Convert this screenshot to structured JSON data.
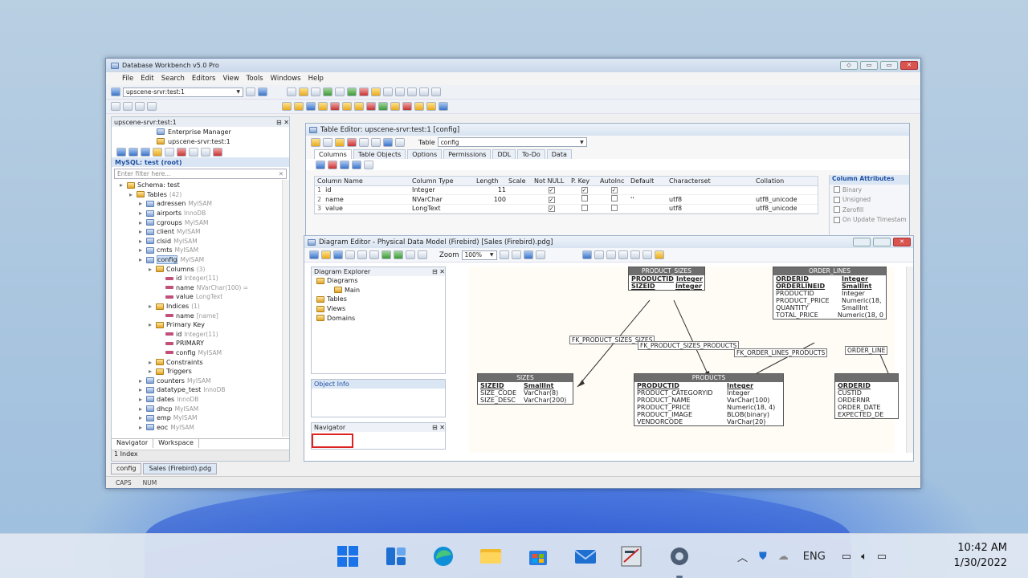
{
  "window": {
    "title": "Database Workbench v5.0 Pro",
    "buttons": [
      "◇",
      "▭",
      "▭",
      "✕"
    ]
  },
  "menu": [
    "File",
    "Edit",
    "Search",
    "Editors",
    "View",
    "Tools",
    "Windows",
    "Help"
  ],
  "toolbar": {
    "server_combo": "upscene-srvr:test:1"
  },
  "left": {
    "header": "upscene-srvr:test:1",
    "items": [
      "Enterprise Manager",
      "upscene-srvr:test:1"
    ],
    "connection": "MySQL: test (root)",
    "filter_placeholder": "Enter filter here...",
    "tree": [
      {
        "label": "Schema: test",
        "extra": "",
        "indent": 0
      },
      {
        "label": "Tables",
        "extra": "(42)",
        "indent": 1
      },
      {
        "label": "adressen",
        "extra": "MyISAM",
        "indent": 2
      },
      {
        "label": "airports",
        "extra": "InnoDB",
        "indent": 2
      },
      {
        "label": "cgroups",
        "extra": "MyISAM",
        "indent": 2
      },
      {
        "label": "client",
        "extra": "MyISAM",
        "indent": 2
      },
      {
        "label": "clsid",
        "extra": "MyISAM",
        "indent": 2
      },
      {
        "label": "cmts",
        "extra": "MyISAM",
        "indent": 2
      },
      {
        "label": "config",
        "extra": "MyISAM",
        "indent": 2,
        "selected": true
      },
      {
        "label": "Columns",
        "extra": "(3)",
        "indent": 3
      },
      {
        "label": "id",
        "extra": "Integer(11)",
        "indent": 4
      },
      {
        "label": "name",
        "extra": "NVarChar(100) =",
        "indent": 4
      },
      {
        "label": "value",
        "extra": "LongText",
        "indent": 4
      },
      {
        "label": "Indices",
        "extra": "(1)",
        "indent": 3
      },
      {
        "label": "name",
        "extra": "[name]",
        "indent": 4
      },
      {
        "label": "Primary Key",
        "extra": "",
        "indent": 3
      },
      {
        "label": "id",
        "extra": "Integer(11)",
        "indent": 4
      },
      {
        "label": "PRIMARY",
        "extra": "",
        "indent": 4
      },
      {
        "label": "config",
        "extra": "MyISAM",
        "indent": 4
      },
      {
        "label": "Constraints",
        "extra": "",
        "indent": 3
      },
      {
        "label": "Triggers",
        "extra": "",
        "indent": 3
      },
      {
        "label": "counters",
        "extra": "MyISAM",
        "indent": 2
      },
      {
        "label": "datatype_test",
        "extra": "InnoDB",
        "indent": 2
      },
      {
        "label": "dates",
        "extra": "InnoDB",
        "indent": 2
      },
      {
        "label": "dhcp",
        "extra": "MyISAM",
        "indent": 2
      },
      {
        "label": "emp",
        "extra": "MyISAM",
        "indent": 2
      },
      {
        "label": "eoc",
        "extra": "MyISAM",
        "indent": 2
      }
    ],
    "tabs": [
      "Navigator",
      "Workspace"
    ],
    "status": "1 Index"
  },
  "table_editor": {
    "title": "Table Editor: upscene-srvr:test:1 [config]",
    "table_label": "Table",
    "table_value": "config",
    "tabs": [
      "Columns",
      "Table Objects",
      "Options",
      "Permissions",
      "DDL",
      "To-Do",
      "Data"
    ],
    "columns": [
      "Column Name",
      "Column Type",
      "Length",
      "Scale",
      "Not NULL",
      "P. Key",
      "AutoInc",
      "Default",
      "Characterset",
      "Collation"
    ],
    "rows": [
      {
        "num": "1",
        "name": "id",
        "type": "Integer",
        "length": "11",
        "scale": "",
        "notnull": true,
        "pkey": true,
        "autoinc": true,
        "default": "",
        "charset": "",
        "collation": ""
      },
      {
        "num": "2",
        "name": "name",
        "type": "NVarChar",
        "length": "100",
        "scale": "",
        "notnull": true,
        "pkey": false,
        "autoinc": false,
        "default": "''",
        "charset": "utf8",
        "collation": "utf8_unicode"
      },
      {
        "num": "3",
        "name": "value",
        "type": "LongText",
        "length": "",
        "scale": "",
        "notnull": true,
        "pkey": false,
        "autoinc": false,
        "default": "",
        "charset": "utf8",
        "collation": "utf8_unicode"
      }
    ],
    "attributes": {
      "title": "Column Attributes",
      "options": [
        "Binary",
        "Unsigned",
        "Zerofill",
        "On Update Timestam"
      ]
    }
  },
  "diagram_editor": {
    "title": "Diagram Editor - Physical Data Model (Firebird) [Sales (Firebird).pdg]",
    "zoom_label": "Zoom",
    "zoom_value": "100%",
    "explorer": {
      "title": "Diagram Explorer",
      "items": [
        {
          "label": "Diagrams",
          "indent": 0
        },
        {
          "label": "Main",
          "indent": 1
        },
        {
          "label": "Tables",
          "indent": 0
        },
        {
          "label": "Views",
          "indent": 0
        },
        {
          "label": "Domains",
          "indent": 0
        }
      ]
    },
    "object_info": "Object Info",
    "navigator": "Navigator",
    "entities": {
      "product_sizes": {
        "name": "PRODUCT_SIZES",
        "rows": [
          [
            "PRODUCTID",
            "Integer",
            true
          ],
          [
            "SIZEID",
            "Integer",
            true
          ]
        ]
      },
      "order_lines": {
        "name": "ORDER_LINES",
        "rows": [
          [
            "ORDERID",
            "Integer",
            true
          ],
          [
            "ORDERLINEID",
            "SmallInt",
            true
          ],
          [
            "PRODUCTID",
            "Integer",
            false
          ],
          [
            "PRODUCT_PRICE",
            "Numeric(18,",
            false
          ],
          [
            "QUANTITY",
            "SmallInt",
            false
          ],
          [
            "TOTAL_PRICE",
            "Numeric(18, 0",
            false
          ]
        ]
      },
      "sizes": {
        "name": "SIZES",
        "rows": [
          [
            "SIZEID",
            "SmallInt",
            true
          ],
          [
            "SIZE_CODE",
            "VarChar(8)",
            false
          ],
          [
            "SIZE_DESC",
            "VarChar(200)",
            false
          ]
        ]
      },
      "products": {
        "name": "PRODUCTS",
        "rows": [
          [
            "PRODUCTID",
            "Integer",
            true
          ],
          [
            "PRODUCT_CATEGORYID",
            "Integer",
            false
          ],
          [
            "PRODUCT_NAME",
            "VarChar(100)",
            false
          ],
          [
            "PRODUCT_PRICE",
            "Numeric(18, 4)",
            false
          ],
          [
            "PRODUCT_IMAGE",
            "BLOB(binary)",
            false
          ],
          [
            "VENDORCODE",
            "VarChar(20)",
            false
          ]
        ]
      },
      "orders": {
        "name": "",
        "rows": [
          [
            "ORDERID",
            "",
            true
          ],
          [
            "CUSTID",
            "",
            false
          ],
          [
            "ORDERNR",
            "",
            false
          ],
          [
            "ORDER_DATE",
            "",
            false
          ],
          [
            "EXPECTED_DE",
            "",
            false
          ]
        ]
      }
    },
    "relations": [
      "FK_PRODUCT_SIZES_SIZES",
      "FK_PRODUCT_SIZES_PRODUCTS",
      "FK_ORDER_LINES_PRODUCTS",
      "ORDER_LINE"
    ]
  },
  "bottom_tabs": [
    "config",
    "Sales (Firebird).pdg"
  ],
  "status": [
    "CAPS",
    "NUM"
  ],
  "taskbar": {
    "language": "ENG",
    "time": "10:42 AM",
    "date": "1/30/2022"
  }
}
